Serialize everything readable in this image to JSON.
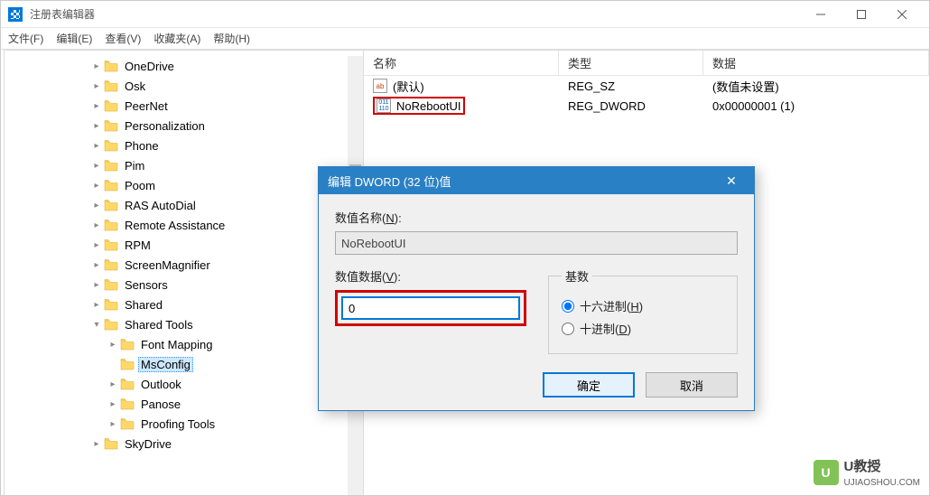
{
  "titlebar": {
    "title": "注册表编辑器"
  },
  "menubar": {
    "file": "文件(F)",
    "edit": "编辑(E)",
    "view": "查看(V)",
    "favorites": "收藏夹(A)",
    "help": "帮助(H)"
  },
  "tree": {
    "items": [
      {
        "depth": 3,
        "twisty": ">",
        "label": "OneDrive"
      },
      {
        "depth": 3,
        "twisty": ">",
        "label": "Osk"
      },
      {
        "depth": 3,
        "twisty": ">",
        "label": "PeerNet"
      },
      {
        "depth": 3,
        "twisty": ">",
        "label": "Personalization"
      },
      {
        "depth": 3,
        "twisty": ">",
        "label": "Phone"
      },
      {
        "depth": 3,
        "twisty": ">",
        "label": "Pim"
      },
      {
        "depth": 3,
        "twisty": ">",
        "label": "Poom"
      },
      {
        "depth": 3,
        "twisty": ">",
        "label": "RAS AutoDial"
      },
      {
        "depth": 3,
        "twisty": ">",
        "label": "Remote Assistance"
      },
      {
        "depth": 3,
        "twisty": ">",
        "label": "RPM"
      },
      {
        "depth": 3,
        "twisty": ">",
        "label": "ScreenMagnifier"
      },
      {
        "depth": 3,
        "twisty": ">",
        "label": "Sensors"
      },
      {
        "depth": 3,
        "twisty": ">",
        "label": "Shared"
      },
      {
        "depth": 3,
        "twisty": "v",
        "label": "Shared Tools"
      },
      {
        "depth": 4,
        "twisty": ">",
        "label": "Font Mapping"
      },
      {
        "depth": 4,
        "twisty": "",
        "label": "MsConfig",
        "selected": true
      },
      {
        "depth": 4,
        "twisty": ">",
        "label": "Outlook"
      },
      {
        "depth": 4,
        "twisty": ">",
        "label": "Panose"
      },
      {
        "depth": 4,
        "twisty": ">",
        "label": "Proofing Tools"
      },
      {
        "depth": 3,
        "twisty": ">",
        "label": "SkyDrive"
      }
    ]
  },
  "list": {
    "headers": {
      "name": "名称",
      "type": "类型",
      "data": "数据"
    },
    "rows": [
      {
        "icon": "ab",
        "name": "(默认)",
        "type": "REG_SZ",
        "data": "(数值未设置)",
        "highlighted": false
      },
      {
        "icon": "dw",
        "name": "NoRebootUI",
        "type": "REG_DWORD",
        "data": "0x00000001 (1)",
        "highlighted": true
      }
    ]
  },
  "dialog": {
    "title": "编辑 DWORD (32 位)值",
    "name_label": "数值名称(N):",
    "name_value": "NoRebootUI",
    "data_label": "数值数据(V):",
    "data_value": "0",
    "radix_legend": "基数",
    "radix_hex": "十六进制(H)",
    "radix_dec": "十进制(D)",
    "ok": "确定",
    "cancel": "取消"
  },
  "watermark": {
    "badge": "U",
    "brand": "U教授",
    "url": "UJIAOSHOU.COM"
  }
}
